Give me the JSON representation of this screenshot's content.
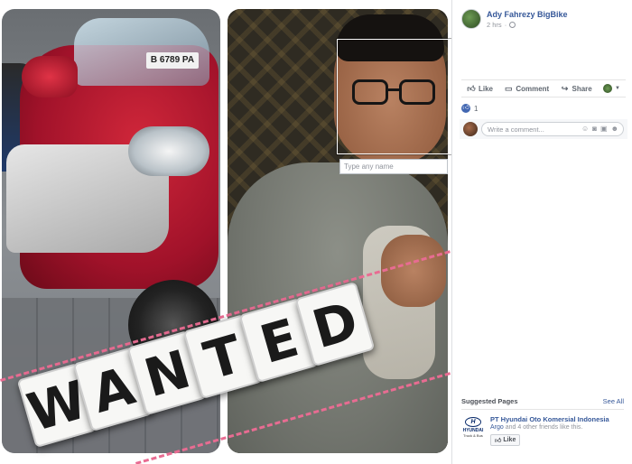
{
  "post": {
    "author": "Ady Fahrezy BigBike",
    "time": "2 hrs",
    "privacy_icon": "globe-icon"
  },
  "photo": {
    "left_plate": "B 6789 PA",
    "tag_placeholder": "Type any name",
    "overlay_letters": [
      "W",
      "A",
      "N",
      "T",
      "E",
      "D"
    ]
  },
  "actions": {
    "like": "Like",
    "comment": "Comment",
    "share": "Share"
  },
  "reactions": {
    "count": "1"
  },
  "comment": {
    "placeholder": "Write a comment..."
  },
  "suggested": {
    "heading": "Suggested Pages",
    "see_all": "See All",
    "page_name": "PT Hyundai Oto Komersial Indonesia",
    "friend_name": "Argo",
    "others": "and 4 other friends",
    "like_suffix": "like this.",
    "like_button": "Like",
    "logo_word": "HYUNDAI",
    "logo_sub": "Truck & Bus",
    "logo_letter": "H"
  },
  "colors": {
    "link_blue": "#365899",
    "tape_pink": "#e86c92",
    "like_blue": "#4267b2"
  }
}
